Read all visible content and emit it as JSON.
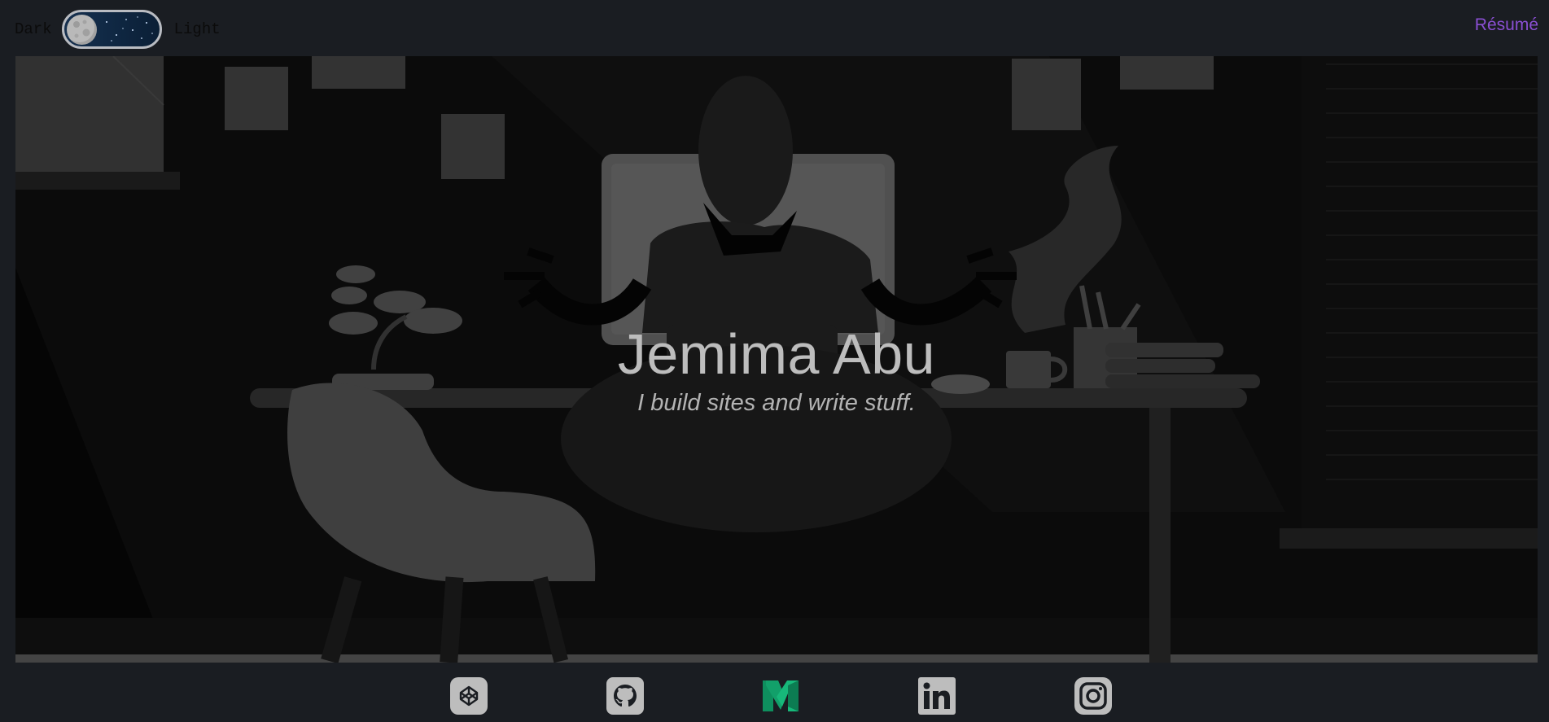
{
  "theme_switch": {
    "left_label": "Dark",
    "right_label": "Light",
    "state": "dark"
  },
  "nav": {
    "resume_label": "Résumé"
  },
  "hero": {
    "title": "Jemima Abu",
    "subtitle": "I build sites and write stuff."
  },
  "socials": [
    {
      "name": "codepen-icon",
      "color": "#bdbdbd"
    },
    {
      "name": "github-icon",
      "color": "#bdbdbd"
    },
    {
      "name": "medium-icon",
      "color": "#1aa06d"
    },
    {
      "name": "linkedin-icon",
      "color": "#bdbdbd"
    },
    {
      "name": "instagram-icon",
      "color": "#bdbdbd"
    }
  ],
  "colors": {
    "background": "#1a1d22",
    "accent": "#8a4fd3",
    "title": "#bdbdbd"
  }
}
